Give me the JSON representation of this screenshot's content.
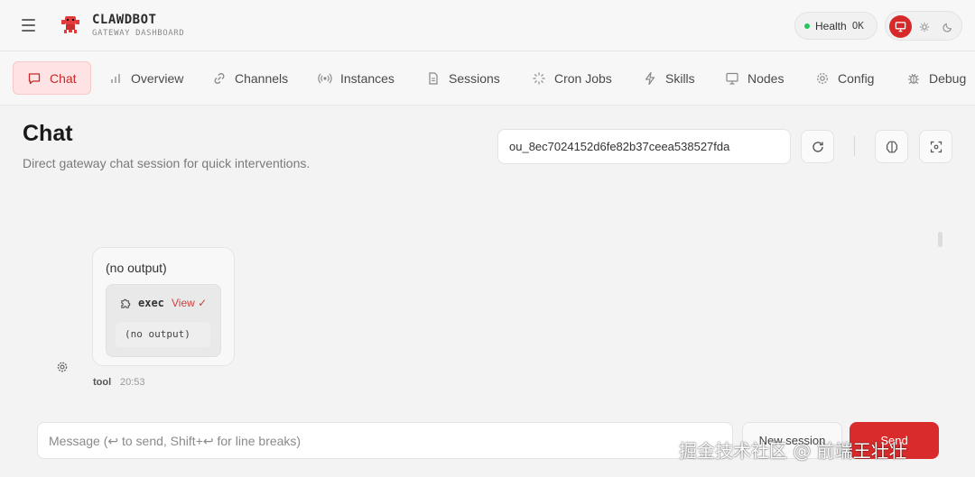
{
  "brand": {
    "name": "CLAWDBOT",
    "subtitle": "GATEWAY DASHBOARD"
  },
  "health": {
    "label": "Health",
    "status": "OK",
    "status_color": "#22c55e"
  },
  "theme": {
    "options": [
      "monitor-icon",
      "sun-icon",
      "moon-icon"
    ],
    "selected": "monitor-icon",
    "accent": "#d62a2a"
  },
  "tabs": [
    {
      "label": "Chat",
      "icon": "chat-icon",
      "active": true
    },
    {
      "label": "Overview",
      "icon": "bar-chart-icon"
    },
    {
      "label": "Channels",
      "icon": "link-icon"
    },
    {
      "label": "Instances",
      "icon": "broadcast-icon"
    },
    {
      "label": "Sessions",
      "icon": "document-icon"
    },
    {
      "label": "Cron Jobs",
      "icon": "loader-icon"
    },
    {
      "label": "Skills",
      "icon": "bolt-icon"
    },
    {
      "label": "Nodes",
      "icon": "monitor-icon"
    },
    {
      "label": "Config",
      "icon": "gear-icon"
    },
    {
      "label": "Debug",
      "icon": "bug-icon"
    }
  ],
  "page": {
    "title": "Chat",
    "subtitle": "Direct gateway chat session for quick interventions."
  },
  "session": {
    "value": "ou_8ec7024152d6fe82b37ceea538527fda"
  },
  "message": {
    "text": "(no output)",
    "tool": {
      "name": "exec",
      "view_label": "View ✓",
      "output": "(no output)"
    },
    "sender": "tool",
    "time": "20:53"
  },
  "composer": {
    "placeholder": "Message (↩ to send, Shift+↩ for line breaks)",
    "new_session_label": "New session",
    "send_label": "Send"
  },
  "watermark": "掘金技术社区 @ 前端王壮壮"
}
